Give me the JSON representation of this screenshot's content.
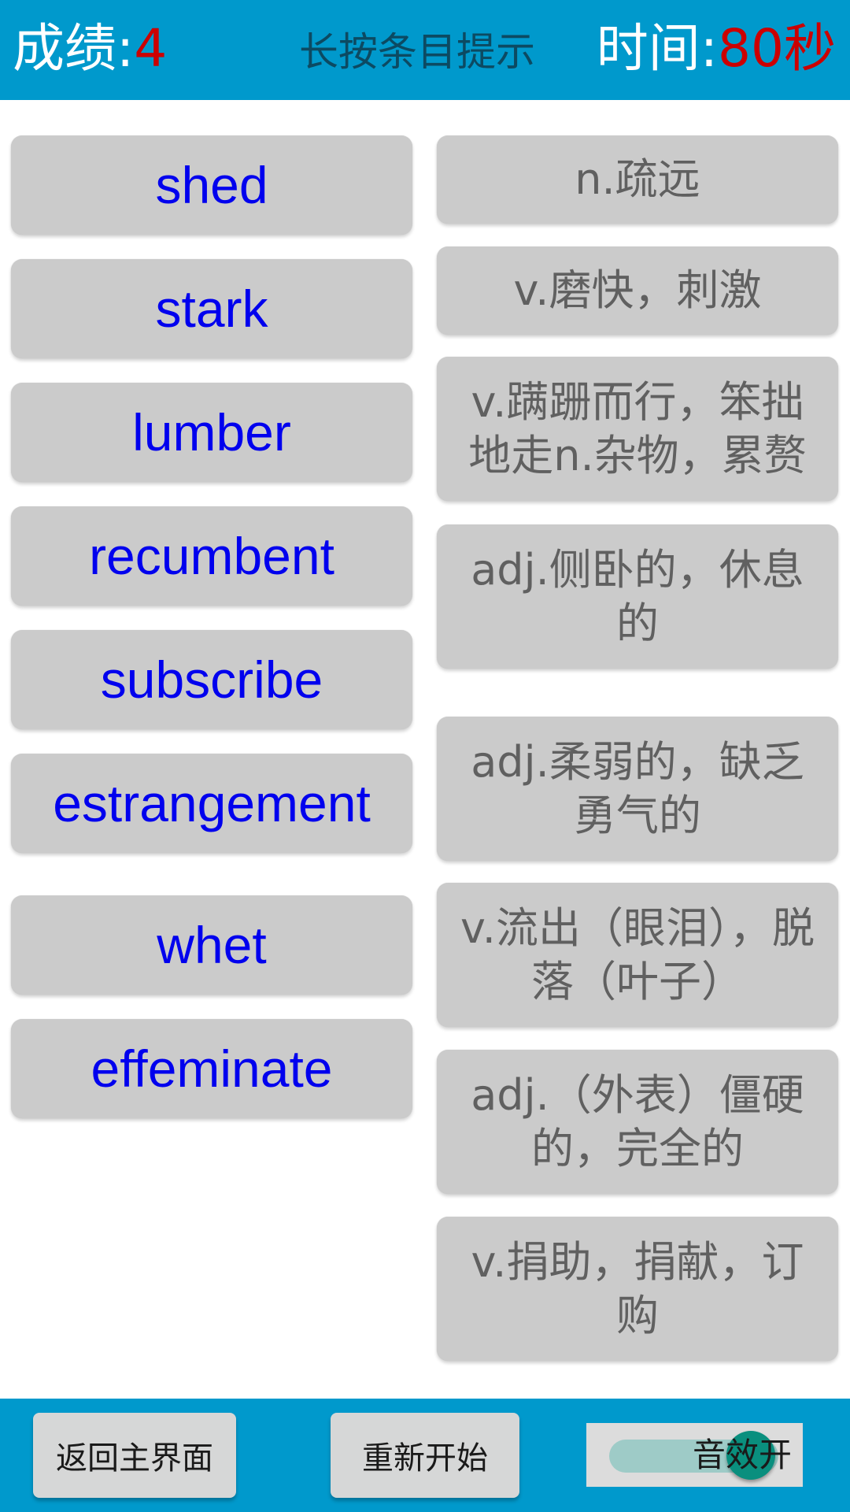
{
  "header": {
    "score_label": "成绩:",
    "score_value": "4",
    "hint_text": "长按条目提示",
    "timer_label": "时间:",
    "timer_value": "80秒"
  },
  "words": [
    "shed",
    "stark",
    "lumber",
    "recumbent",
    "subscribe",
    "estrangement",
    "whet",
    "effeminate"
  ],
  "definitions": [
    "n.疏远",
    "v.磨快，刺激",
    "v.蹒跚而行，笨拙地走n.杂物，累赘",
    "adj.侧卧的，休息的",
    "adj.柔弱的，缺乏勇气的",
    "v.流出（眼泪），脱落（叶子）",
    "adj.（外表）僵硬的，完全的",
    "v.捐助，捐献，订购"
  ],
  "footer": {
    "home_button": "返回主界面",
    "restart_button": "重新开始",
    "sound_toggle_label": "音效开",
    "sound_on": true
  },
  "colors": {
    "bar": "#0099cc",
    "value_red": "#cc0000",
    "word_blue": "#0000ee",
    "def_gray": "#606060",
    "card_bg": "#cbcbcb",
    "switch_thumb": "#0a8f7e"
  }
}
